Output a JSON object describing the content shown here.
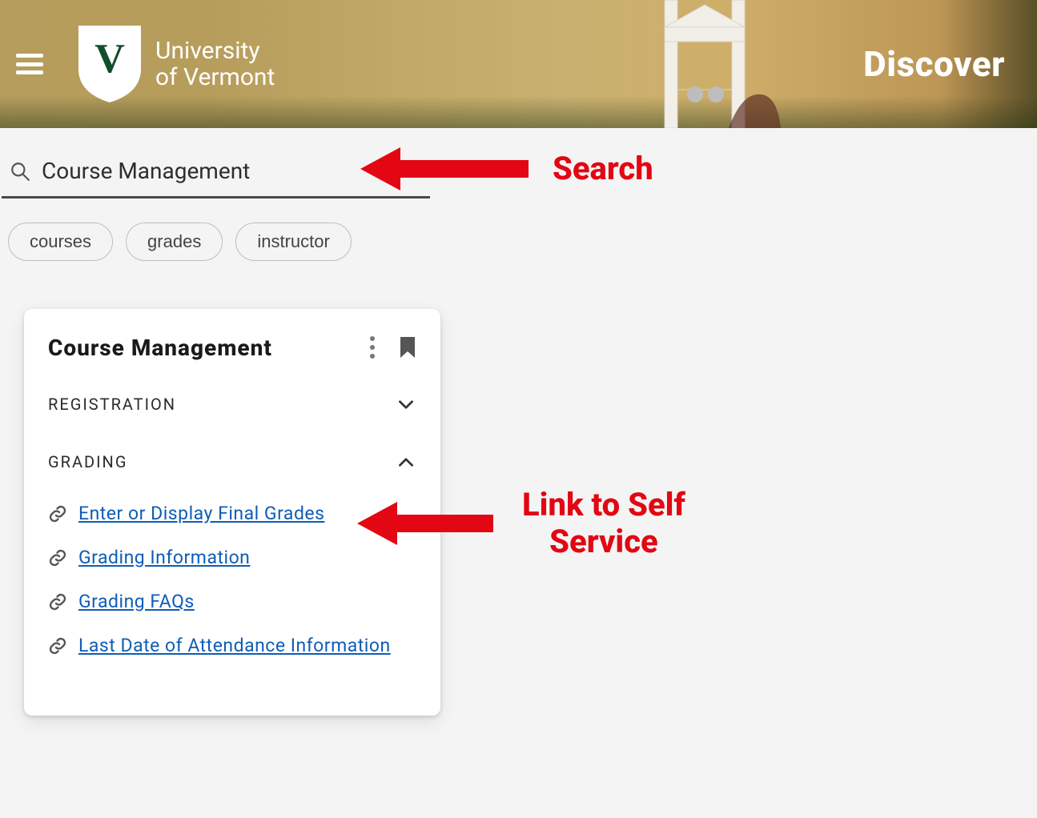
{
  "header": {
    "brand_line1": "University",
    "brand_line2": "of Vermont",
    "discover_label": "Discover"
  },
  "search": {
    "value": "Course Management"
  },
  "chips": [
    {
      "label": "courses"
    },
    {
      "label": "grades"
    },
    {
      "label": "instructor"
    }
  ],
  "card": {
    "title": "Course  Management",
    "sections": {
      "registration": {
        "title": "REGISTRATION",
        "expanded": false
      },
      "grading": {
        "title": "GRADING",
        "expanded": true,
        "links": [
          "Enter  or  Display  Final  Grades",
          "Grading  Information",
          "Grading  FAQs",
          "Last  Date  of  Attendance  Information"
        ]
      }
    }
  },
  "annotations": {
    "search": "Search",
    "self_service_line1": "Link to Self",
    "self_service_line2": "Service"
  }
}
